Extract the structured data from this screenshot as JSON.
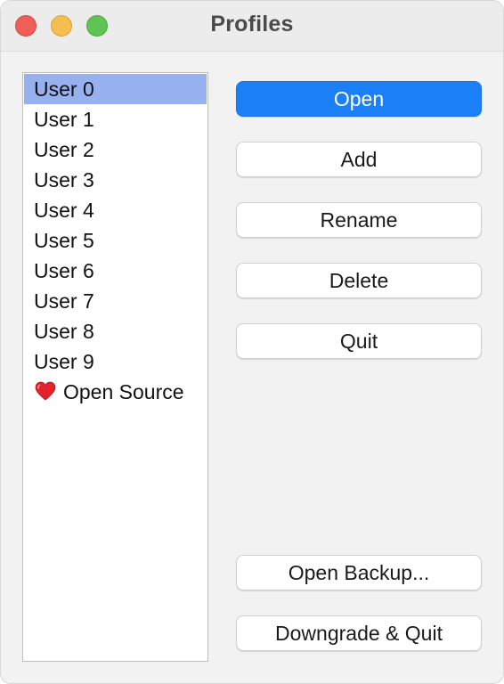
{
  "window": {
    "title": "Profiles"
  },
  "profiles": {
    "items": [
      {
        "label": "User 0",
        "selected": true
      },
      {
        "label": "User 1"
      },
      {
        "label": "User 2"
      },
      {
        "label": "User 3"
      },
      {
        "label": "User 4"
      },
      {
        "label": "User 5"
      },
      {
        "label": "User 6"
      },
      {
        "label": "User 7"
      },
      {
        "label": "User 8"
      },
      {
        "label": "User 9"
      },
      {
        "label": "Open Source",
        "icon": "heart-icon"
      }
    ]
  },
  "buttons": {
    "open": "Open",
    "add": "Add",
    "rename": "Rename",
    "delete": "Delete",
    "quit": "Quit",
    "open_backup": "Open Backup...",
    "downgrade_quit": "Downgrade & Quit"
  },
  "colors": {
    "accent": "#1b80f7",
    "selection": "#97b1f0",
    "close": "#ee5f57",
    "minimize": "#f5be4f",
    "maximize": "#5fc454"
  }
}
